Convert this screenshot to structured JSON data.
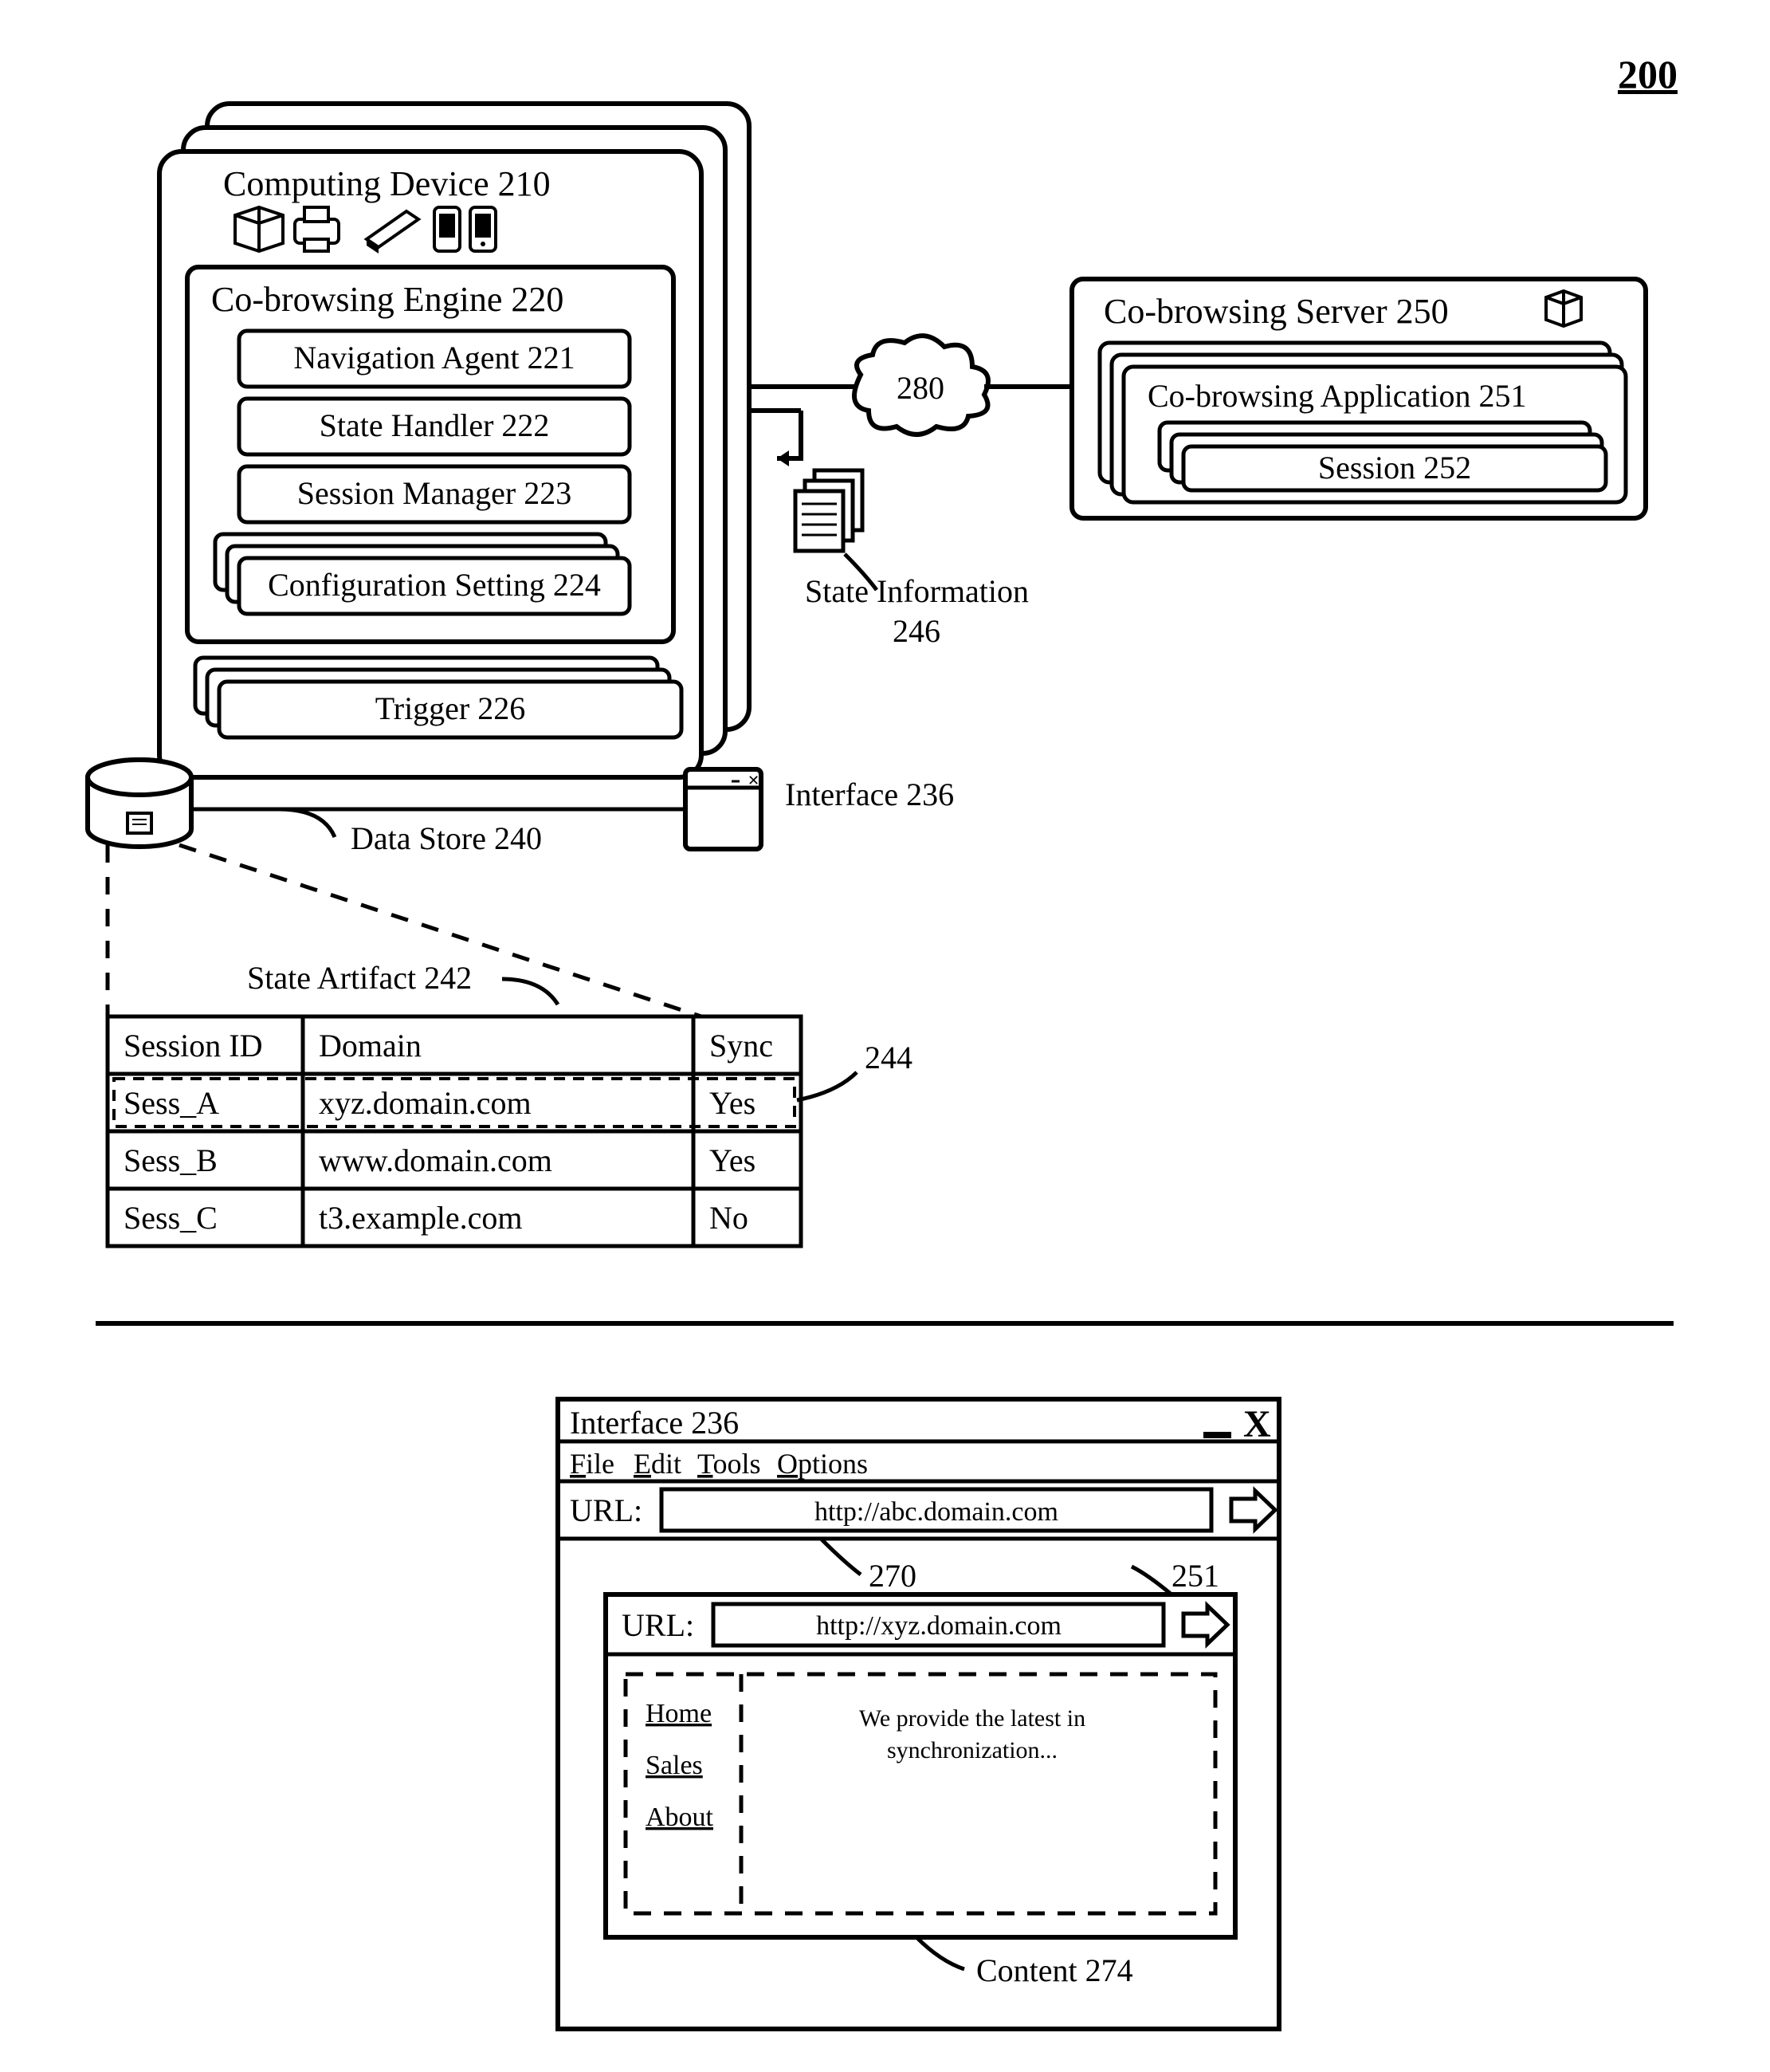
{
  "figure_number": "200",
  "device": {
    "title": "Computing Device 210",
    "engine": {
      "title": "Co-browsing Engine 220",
      "items": [
        "Navigation Agent 221",
        "State Handler 222",
        "Session Manager 223",
        "Configuration Setting 224"
      ],
      "trigger": "Trigger 226"
    }
  },
  "datastore_label": "Data Store 240",
  "state_info_label": "State Information",
  "state_info_num": "246",
  "interface_label": "Interface 236",
  "network_label": "280",
  "server": {
    "title": "Co-browsing Server 250",
    "app": "Co-browsing Application 251",
    "session": "Session 252"
  },
  "state_artifact_label": "State Artifact 242",
  "row_ref": "244",
  "table": {
    "headers": [
      "Session ID",
      "Domain",
      "Sync"
    ],
    "rows": [
      [
        "Sess_A",
        "xyz.domain.com",
        "Yes"
      ],
      [
        "Sess_B",
        "www.domain.com",
        "Yes"
      ],
      [
        "Sess_C",
        "t3.example.com",
        "No"
      ]
    ]
  },
  "browser": {
    "title": "Interface 236",
    "menu": [
      "File",
      "Edit",
      "Tools",
      "Options"
    ],
    "url_label": "URL:",
    "outer_url": "http://abc.domain.com",
    "outer_ref": "270",
    "inner_ref": "251",
    "inner_url": "http://xyz.domain.com",
    "nav": [
      "Home",
      "Sales",
      "About"
    ],
    "content_text": "We provide the latest in synchronization...",
    "content_label": "Content 274"
  }
}
